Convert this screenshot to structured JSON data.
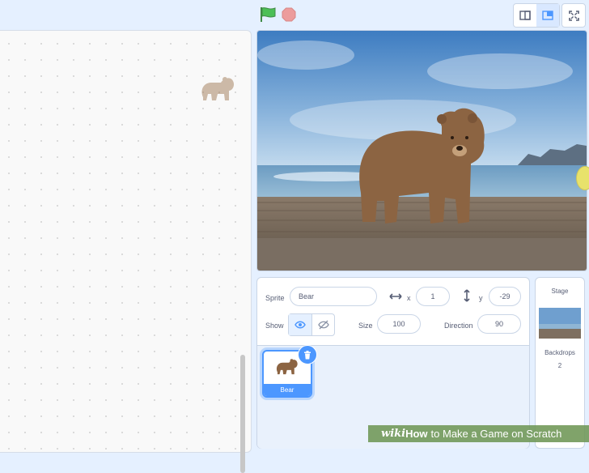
{
  "controls": {
    "green_flag_icon": "green-flag-icon",
    "stop_icon": "stop-sign-icon",
    "color_flag": "#4cbf56",
    "color_stop": "#ec9c9c"
  },
  "stage_modes": {
    "small_stage_icon": "small-stage-icon",
    "large_stage_icon": "large-stage-icon",
    "fullscreen_icon": "fullscreen-icon"
  },
  "sprite_info": {
    "sprite_label": "Sprite",
    "sprite_name": "Bear",
    "x_label": "x",
    "x_value": "1",
    "y_label": "y",
    "y_value": "-29",
    "show_label": "Show",
    "size_label": "Size",
    "size_value": "100",
    "direction_label": "Direction",
    "direction_value": "90"
  },
  "sprites": [
    {
      "name": "Bear",
      "selected": true
    }
  ],
  "stage_pane": {
    "title": "Stage",
    "backdrops_label": "Backdrops",
    "backdrops_count": "2"
  },
  "watermark": {
    "prefix": "wiki",
    "bold": "How",
    "rest": "to Make a Game on Scratch"
  },
  "accent": "#4c97ff"
}
